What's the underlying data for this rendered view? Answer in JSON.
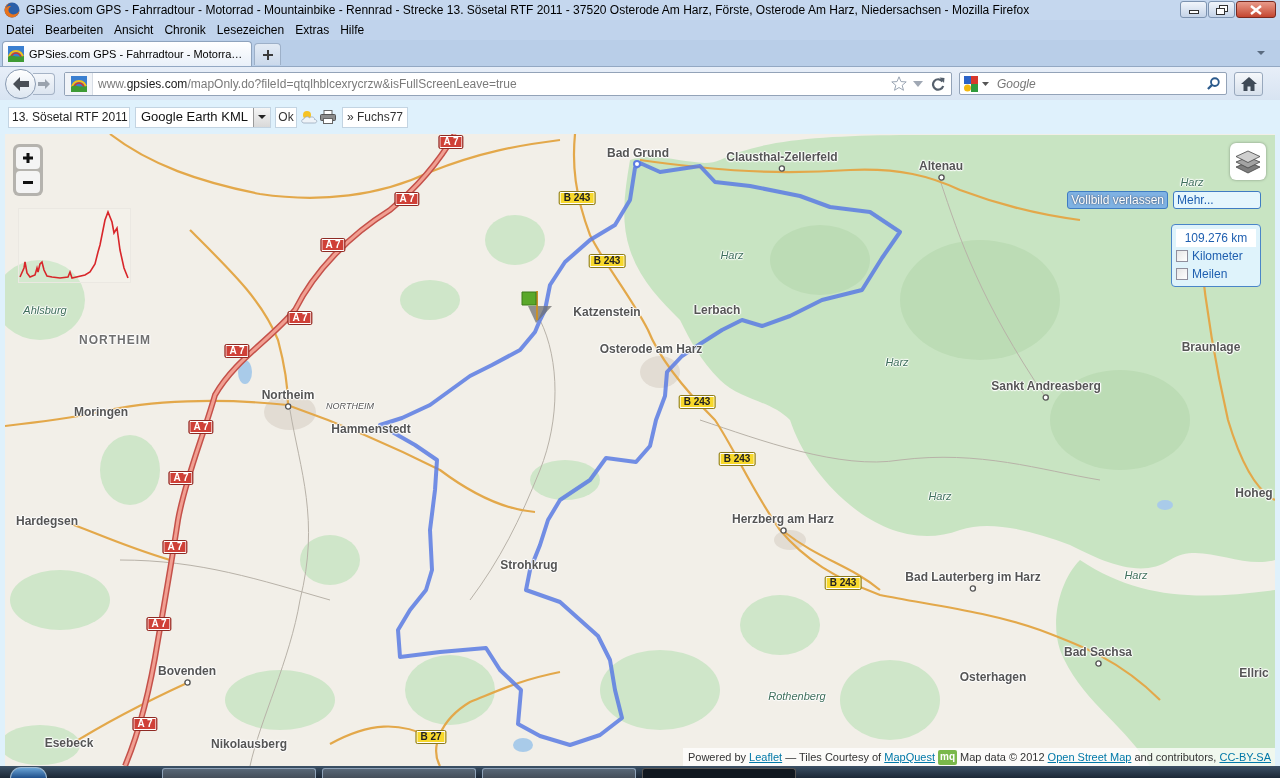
{
  "window": {
    "title": "GPSies.com GPS - Fahrradtour - Motorrad - Mountainbike - Rennrad - Strecke 13. Sösetal RTF 2011 - 37520 Osterode Am Harz, Förste, Osterode Am Harz, Niedersachsen - Mozilla Firefox",
    "menu": [
      "Datei",
      "Bearbeiten",
      "Ansicht",
      "Chronik",
      "Lesezeichen",
      "Extras",
      "Hilfe"
    ]
  },
  "tabs": [
    {
      "label": "GPSies.com GPS - Fahrradtour - Motorra…",
      "selected": true
    }
  ],
  "address_bar": {
    "url": [
      {
        "text": "www.",
        "kind": "dim"
      },
      {
        "text": "gpsies.com",
        "kind": "host"
      },
      {
        "text": "/mapOnly.do?fileId=qtqlhblcexrycrzw&isFullScreenLeave=true",
        "kind": "dim"
      }
    ]
  },
  "search": {
    "placeholder": "Google"
  },
  "toolbar": {
    "track_name": "13. Sösetal RTF 2011",
    "format": "Google Earth KML",
    "ok": "Ok",
    "user_link": "» Fuchs77"
  },
  "map": {
    "fullscreen_exit": "Vollbild verlassen",
    "more": "Mehr...",
    "distance": {
      "value": "109.276 km",
      "units": [
        {
          "label": "Kilometer",
          "checked": false
        },
        {
          "label": "Meilen",
          "checked": false
        }
      ]
    },
    "labels": [
      {
        "text": "Bad Grund",
        "kind": "place"
      },
      {
        "text": "Clausthal-Zellerfeld",
        "kind": "town"
      },
      {
        "text": "Altenau",
        "kind": "town"
      },
      {
        "text": "Harz",
        "kind": "nature"
      },
      {
        "text": "Harz",
        "kind": "nature"
      },
      {
        "text": "Ahlsburg",
        "kind": "nature"
      },
      {
        "text": "Katzenstein",
        "kind": "place"
      },
      {
        "text": "Lerbach",
        "kind": "place"
      },
      {
        "text": "NORTHEIM",
        "kind": "region"
      },
      {
        "text": "Osterode am Harz",
        "kind": "place"
      },
      {
        "text": "Braunlage",
        "kind": "place"
      },
      {
        "text": "Harz",
        "kind": "nature"
      },
      {
        "text": "Sankt Andreasberg",
        "kind": "town"
      },
      {
        "text": "Northeim",
        "kind": "town"
      },
      {
        "text": "NORTHEIM",
        "kind": "district"
      },
      {
        "text": "Moringen",
        "kind": "place"
      },
      {
        "text": "Hammenstedt",
        "kind": "place"
      },
      {
        "text": "Hoheg",
        "kind": "place"
      },
      {
        "text": "Harz",
        "kind": "nature"
      },
      {
        "text": "Hardegsen",
        "kind": "place"
      },
      {
        "text": "Herzberg am Harz",
        "kind": "town"
      },
      {
        "text": "Strohkrug",
        "kind": "place"
      },
      {
        "text": "Harz",
        "kind": "nature"
      },
      {
        "text": "Bad Lauterberg im Harz",
        "kind": "town"
      },
      {
        "text": "Bad Sachsa",
        "kind": "town"
      },
      {
        "text": "Bovenden",
        "kind": "town"
      },
      {
        "text": "Ellric",
        "kind": "place"
      },
      {
        "text": "Osterhagen",
        "kind": "place"
      },
      {
        "text": "Rothenberg",
        "kind": "nature"
      },
      {
        "text": "Esebeck",
        "kind": "place"
      },
      {
        "text": "Nikolausberg",
        "kind": "place"
      }
    ],
    "road_shields": [
      {
        "text": "A 7",
        "kind": "motorway"
      },
      {
        "text": "B 243",
        "kind": "federal"
      },
      {
        "text": "A 7",
        "kind": "motorway"
      },
      {
        "text": "A 7",
        "kind": "motorway"
      },
      {
        "text": "B 243",
        "kind": "federal"
      },
      {
        "text": "A 7",
        "kind": "motorway"
      },
      {
        "text": "A 7",
        "kind": "motorway"
      },
      {
        "text": "B 243",
        "kind": "federal"
      },
      {
        "text": "A 7",
        "kind": "motorway"
      },
      {
        "text": "B 243",
        "kind": "federal"
      },
      {
        "text": "A 7",
        "kind": "motorway"
      },
      {
        "text": "A 7",
        "kind": "motorway"
      },
      {
        "text": "B 243",
        "kind": "federal"
      },
      {
        "text": "A 7",
        "kind": "motorway"
      },
      {
        "text": "A 7",
        "kind": "motorway"
      },
      {
        "text": "B 27",
        "kind": "federal"
      }
    ],
    "attribution": {
      "tiles": [
        {
          "text": "Powered by ",
          "kind": "text"
        },
        {
          "text": "Leaflet",
          "kind": "link"
        },
        {
          "text": " — Tiles Courtesy of ",
          "kind": "text"
        },
        {
          "text": "MapQuest",
          "kind": "link"
        }
      ],
      "logo": "mq",
      "data": [
        {
          "text": "Map data © 2012 ",
          "kind": "text"
        },
        {
          "text": "Open Street Map",
          "kind": "link"
        },
        {
          "text": " and contributors, ",
          "kind": "text"
        },
        {
          "text": "CC-BY-SA",
          "kind": "link"
        }
      ]
    }
  }
}
